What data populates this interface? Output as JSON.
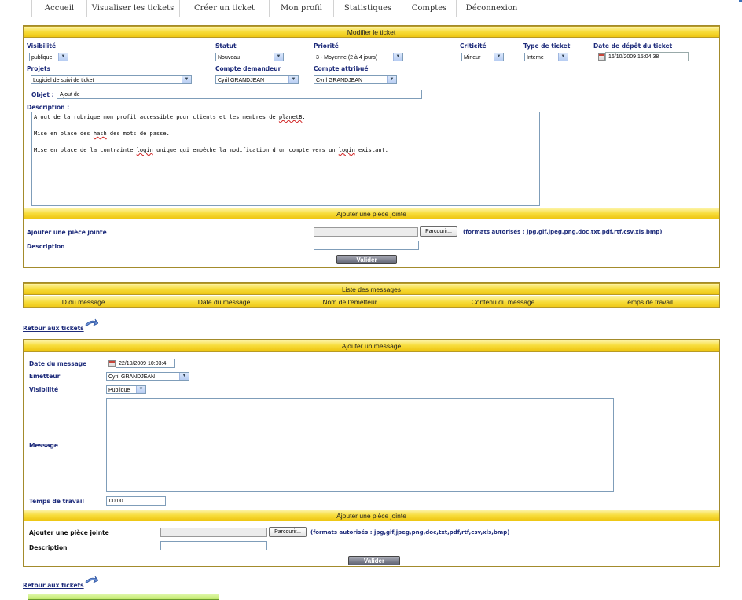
{
  "nav": {
    "items": [
      "Accueil",
      "Visualiser les tickets",
      "Créer un ticket",
      "Mon profil",
      "Statistiques",
      "Comptes",
      "Déconnexion"
    ]
  },
  "edit_ticket": {
    "title": "Modifier le ticket",
    "visibilite": {
      "label": "Visibilité",
      "value": "publique"
    },
    "statut": {
      "label": "Statut",
      "value": "Nouveau"
    },
    "priorite": {
      "label": "Priorité",
      "value": "3 - Moyenne (2 à 4 jours)"
    },
    "criticite": {
      "label": "Criticité",
      "value": "Mineur"
    },
    "type": {
      "label": "Type de ticket",
      "value": "Interne"
    },
    "date_depot": {
      "label": "Date de dépôt du ticket",
      "value": "16/10/2009 15:04:38"
    },
    "projets": {
      "label": "Projets",
      "value": "Logiciel de suivi de ticket"
    },
    "compte_demandeur": {
      "label": "Compte demandeur",
      "value": "Cyril GRANDJEAN"
    },
    "compte_attribue": {
      "label": "Compte attribué",
      "value": "Cyril GRANDJEAN"
    },
    "objet": {
      "label": "Objet :",
      "value": "Ajout de"
    },
    "description": {
      "label": "Description :",
      "line1_a": "Ajout de la rubrique mon profil accessible pour clients et les membres de ",
      "line1_b": "planetB",
      "line1_c": ".",
      "line2_a": "Mise en place des ",
      "line2_b": "hash",
      "line2_c": " des mots de passe.",
      "line3_a": "Mise en place de la contrainte ",
      "line3_b": "login",
      "line3_c": " unique qui empêche la modification d'un compte vers un ",
      "line3_d": "login",
      "line3_e": " existant."
    }
  },
  "attach1": {
    "title": "Ajouter une pièce jointe",
    "file_label": "Ajouter une pièce jointe",
    "browse": "Parcourir...",
    "formats": "(formats autorisés : jpg,gif,jpeg,png,doc,txt,pdf,rtf,csv,xls,bmp)",
    "desc_label": "Description",
    "submit": "Valider"
  },
  "messages": {
    "title": "Liste des messages",
    "columns": [
      "ID du message",
      "Date du message",
      "Nom de l'émetteur",
      "Contenu du message",
      "Temps de travail"
    ]
  },
  "back_link": "Retour aux tickets",
  "add_message": {
    "title": "Ajouter un message",
    "date_label": "Date du message",
    "date_value": "22/10/2009 10:03:4",
    "emetteur_label": "Emetteur",
    "emetteur_value": "Cyril GRANDJEAN",
    "visibilite_label": "Visibilité",
    "visibilite_value": "Publique",
    "message_label": "Message",
    "temps_label": "Temps de travail",
    "temps_value": "00:00"
  },
  "attach2": {
    "title": "Ajouter une pièce jointe",
    "file_label": "Ajouter une pièce jointe",
    "browse": "Parcourir...",
    "formats": "(formats autorisés : jpg,gif,jpeg,png,doc,txt,pdf,rtf,csv,xls,bmp)",
    "desc_label": "Description",
    "submit": "Valider"
  },
  "back_link2": "Retour aux tickets",
  "colors": {
    "bar_yellow": "#f7dc3a",
    "label_blue": "#1c2a7a",
    "panel_border": "#a38b2c"
  }
}
